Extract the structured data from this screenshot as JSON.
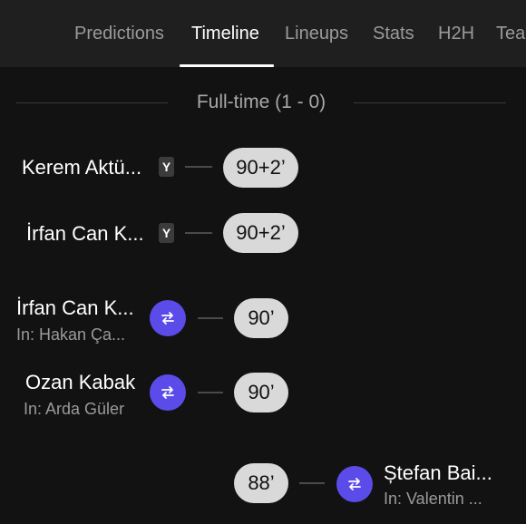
{
  "tabs": [
    {
      "label": "Predictions",
      "active": false
    },
    {
      "label": "Timeline",
      "active": true
    },
    {
      "label": "Lineups",
      "active": false
    },
    {
      "label": "Stats",
      "active": false
    },
    {
      "label": "H2H",
      "active": false
    },
    {
      "label": "Tea",
      "active": false
    }
  ],
  "fulltime_label": "Full-time (1 - 0)",
  "events": [
    {
      "type": "yellow-card",
      "player": "Kerem Aktü...",
      "card": "Y",
      "minute": "90+2’"
    },
    {
      "type": "yellow-card",
      "player": "İrfan Can K...",
      "card": "Y",
      "minute": "90+2’"
    },
    {
      "type": "substitution",
      "player": "İrfan Can K...",
      "sub_in": "In: Hakan Ça...",
      "minute": "90’"
    },
    {
      "type": "substitution",
      "player": "Ozan Kabak",
      "sub_in": "In: Arda Güler",
      "minute": "90’"
    },
    {
      "type": "substitution",
      "player": "Ștefan Bai...",
      "sub_in": "In: Valentin ...",
      "minute": "88’"
    }
  ],
  "colors": {
    "background": "#121212",
    "tabbar": "#1f1f1f",
    "sub_icon": "#5b4cea",
    "pill": "#d9d9d9"
  },
  "icons": {
    "substitution": "swap-arrows-icon"
  }
}
